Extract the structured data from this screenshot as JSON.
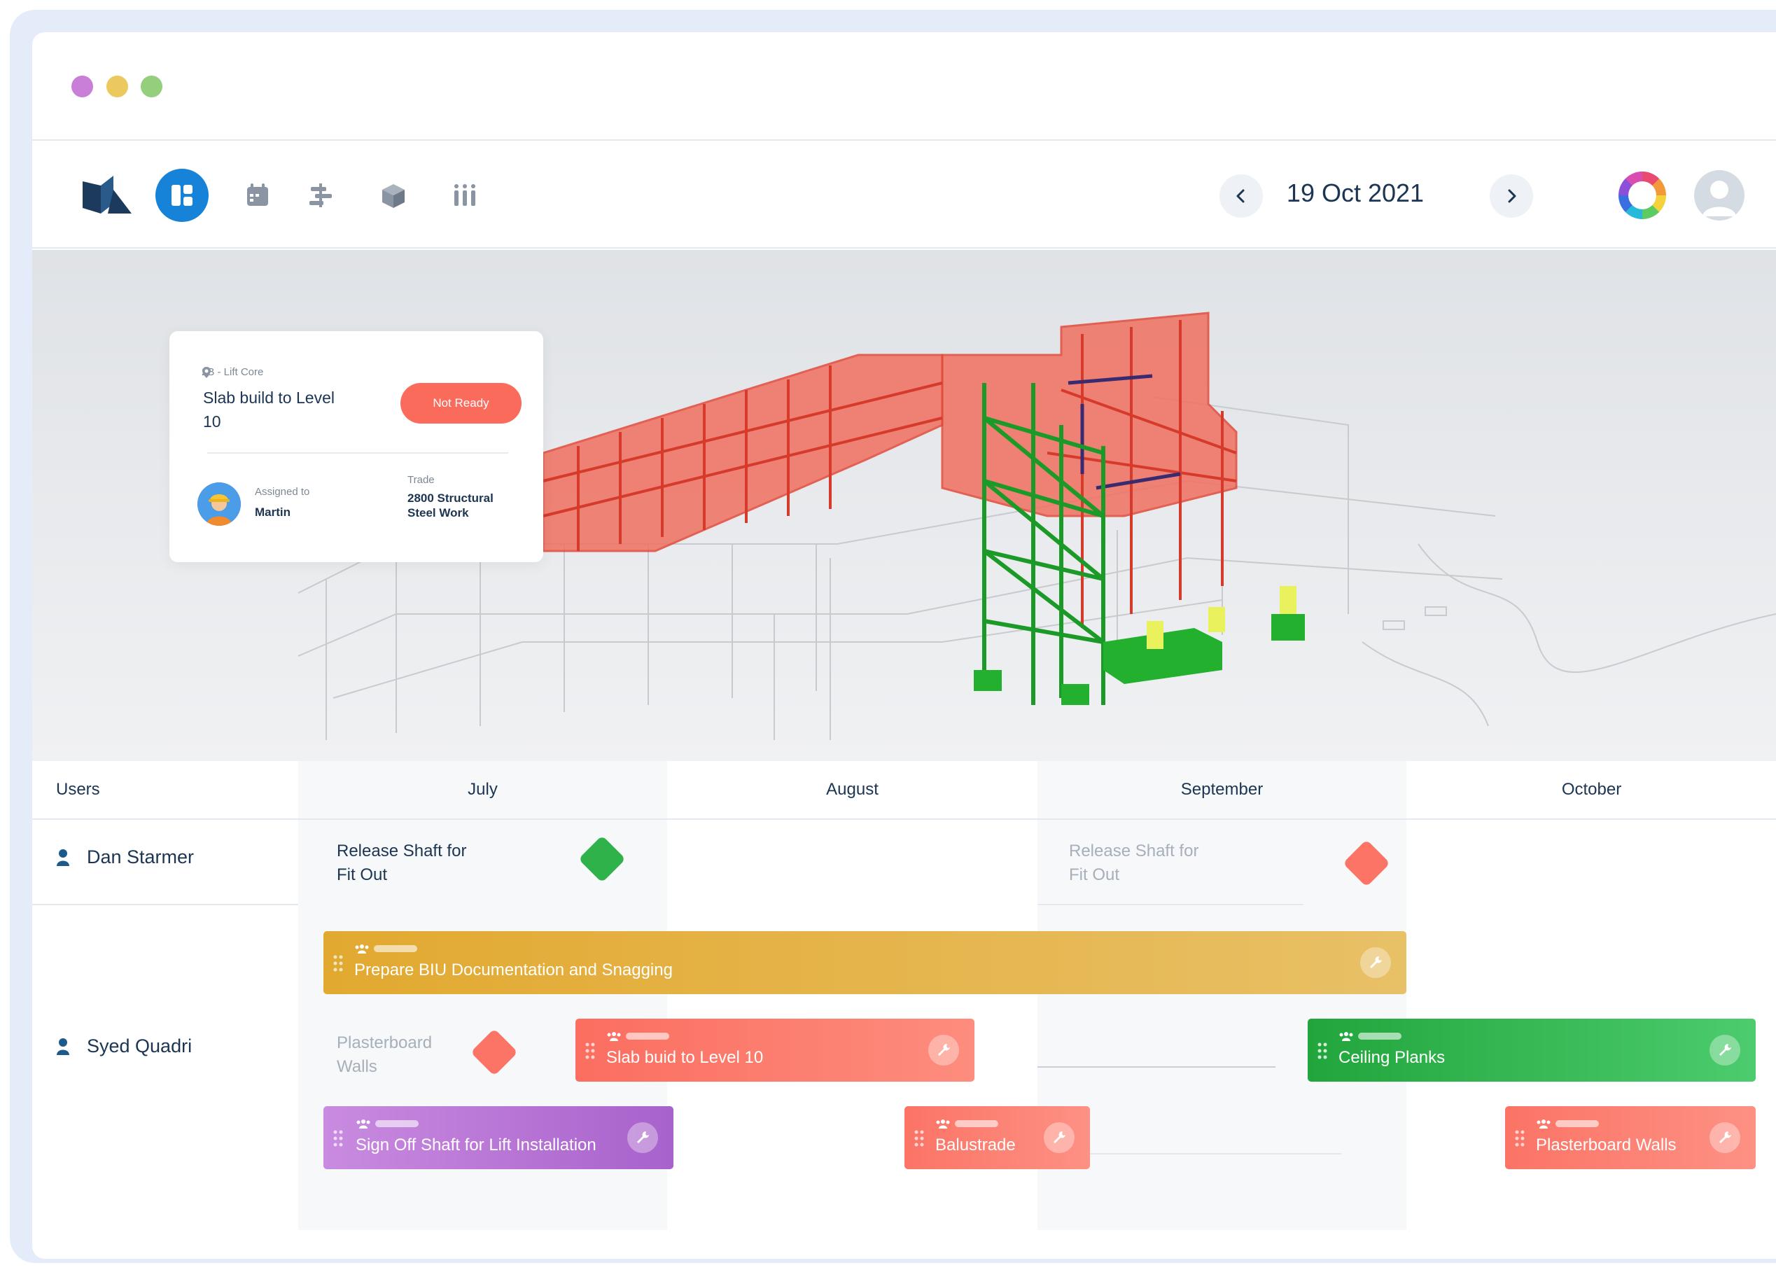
{
  "toolbar": {
    "date": "19 Oct 2021",
    "icons": [
      "logo-icon",
      "board-icon",
      "calendar-icon",
      "gantt-icon",
      "cube-icon",
      "columns-icon"
    ]
  },
  "task_card": {
    "location": "2B - Lift Core",
    "title": "Slab build to Level 10",
    "status": "Not Ready",
    "assigned_label": "Assigned to",
    "assigned_name": "Martin",
    "trade_label": "Trade",
    "trade_value": "2800 Structural Steel Work"
  },
  "timeline": {
    "users_header": "Users",
    "months": [
      "July",
      "August",
      "September",
      "October"
    ],
    "users": [
      "Dan Starmer",
      "Syed Quadri"
    ],
    "milestones": [
      {
        "label": "Release Shaft for Fit Out",
        "color": "#2fb24a",
        "faded": false
      },
      {
        "label": "Release Shaft for Fit Out",
        "color": "#fb7466",
        "faded": true
      },
      {
        "label": "Plasterboard Walls",
        "color": "#fb7466",
        "faded": true
      }
    ],
    "tasks": [
      {
        "label": "Prepare BIU Documentation and Snagging",
        "color": "#e4ad3a"
      },
      {
        "label": "Slab buid to Level 10",
        "color": "#fb7466"
      },
      {
        "label": "Ceiling Planks",
        "color": "#2fb24a"
      },
      {
        "label": "Sign Off Shaft for Lift Installation",
        "color": "#b46ed6"
      },
      {
        "label": "Balustrade",
        "color": "#fb7466"
      },
      {
        "label": "Plasterboard Walls",
        "color": "#fb7466"
      }
    ]
  },
  "colors": {
    "accent": "#1683d8",
    "status_not_ready": "#fb6b5b",
    "text_dark": "#1c3552"
  }
}
